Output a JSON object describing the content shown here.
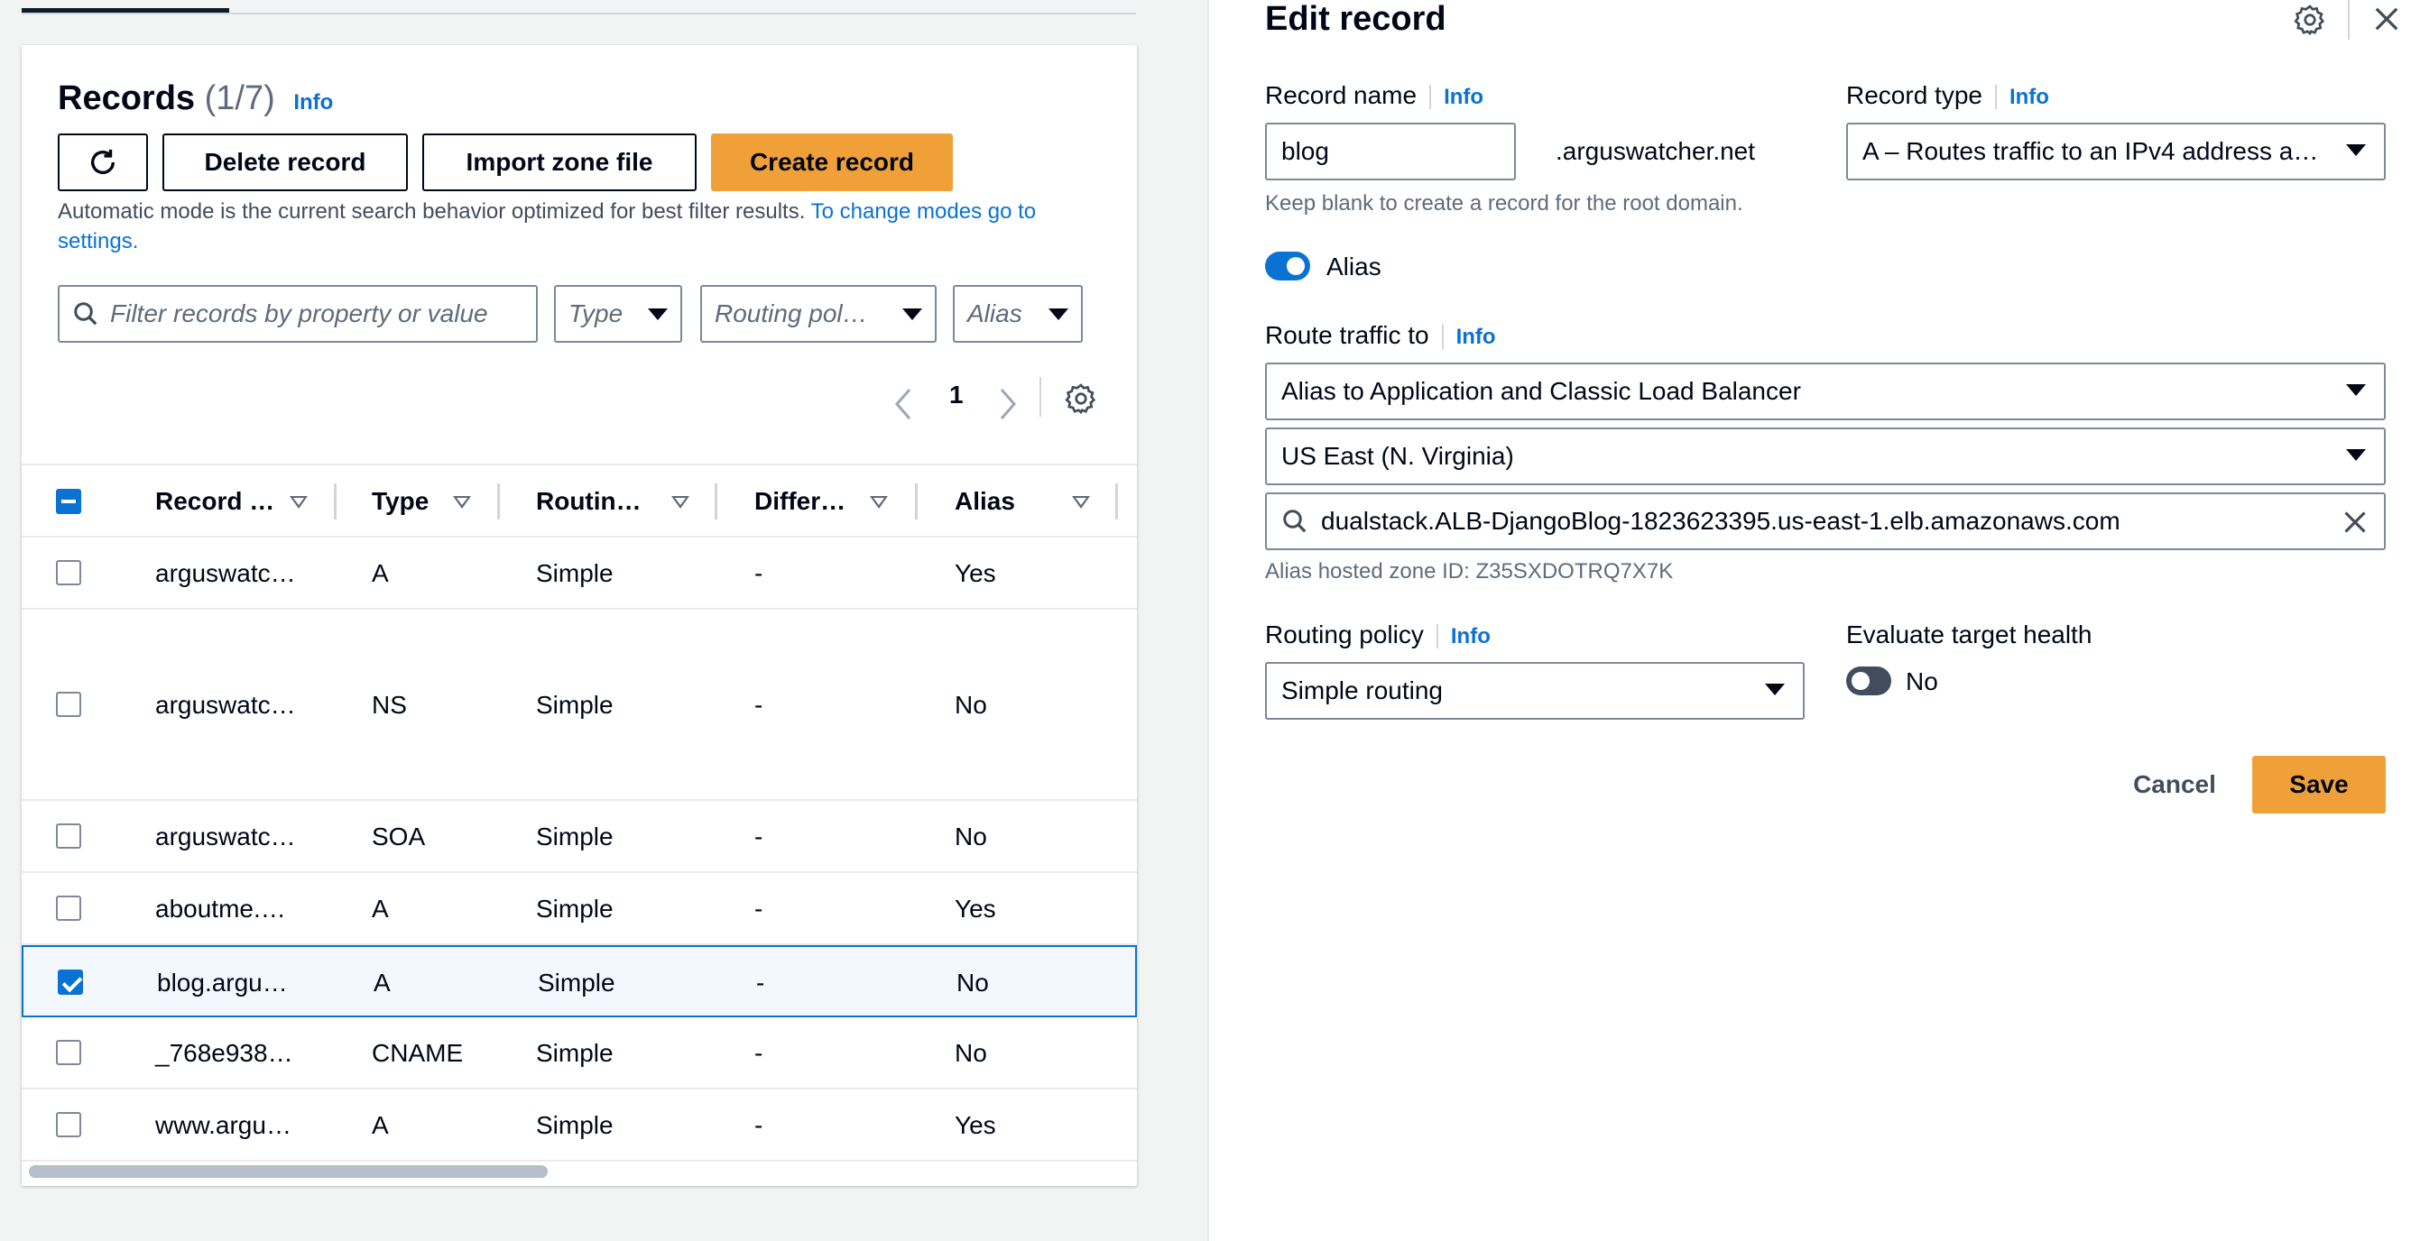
{
  "records": {
    "title": "Records",
    "count": "(1/7)",
    "info": "Info",
    "buttons": {
      "delete": "Delete record",
      "import": "Import zone file",
      "create": "Create record"
    },
    "hint_text": "Automatic mode is the current search behavior optimized for best filter results.",
    "hint_link": "To change modes go to settings.",
    "filters": {
      "search_placeholder": "Filter records by property or value",
      "type": "Type",
      "routing": "Routing pol…",
      "alias": "Alias"
    },
    "page": "1",
    "columns": [
      "Record …",
      "Type",
      "Routin…",
      "Differ…",
      "Alias"
    ],
    "rows": [
      {
        "name": "arguswatc…",
        "type": "A",
        "routing": "Simple",
        "diff": "-",
        "alias": "Yes",
        "checked": false
      },
      {
        "name": "arguswatc…",
        "type": "NS",
        "routing": "Simple",
        "diff": "-",
        "alias": "No",
        "checked": false
      },
      {
        "name": "arguswatc…",
        "type": "SOA",
        "routing": "Simple",
        "diff": "-",
        "alias": "No",
        "checked": false
      },
      {
        "name": "aboutme.…",
        "type": "A",
        "routing": "Simple",
        "diff": "-",
        "alias": "Yes",
        "checked": false
      },
      {
        "name": "blog.argu…",
        "type": "A",
        "routing": "Simple",
        "diff": "-",
        "alias": "No",
        "checked": true
      },
      {
        "name": "_768e938…",
        "type": "CNAME",
        "routing": "Simple",
        "diff": "-",
        "alias": "No",
        "checked": false
      },
      {
        "name": "www.argu…",
        "type": "A",
        "routing": "Simple",
        "diff": "-",
        "alias": "Yes",
        "checked": false
      }
    ]
  },
  "editor": {
    "title": "Edit record",
    "record_name_label": "Record name",
    "record_name_value": "blog",
    "domain_suffix": ".arguswatcher.net",
    "record_name_hint": "Keep blank to create a record for the root domain.",
    "record_type_label": "Record type",
    "record_type_value": "A – Routes traffic to an IPv4 address a…",
    "alias_label": "Alias",
    "alias_on": true,
    "route_label": "Route traffic to",
    "route_target": "Alias to Application and Classic Load Balancer",
    "region": "US East (N. Virginia)",
    "endpoint": "dualstack.ALB-DjangoBlog-1823623395.us-east-1.elb.amazonaws.com",
    "hosted_zone": "Alias hosted zone ID: Z35SXDOTRQ7X7K",
    "routing_policy_label": "Routing policy",
    "routing_policy_value": "Simple routing",
    "eval_health_label": "Evaluate target health",
    "eval_health_value": "No",
    "eval_health_on": false,
    "info": "Info",
    "cancel": "Cancel",
    "save": "Save"
  },
  "colors": {
    "primary": "#f0a039",
    "link": "#0972d3",
    "toggle_on": "#0972d3",
    "toggle_off": "#414d5c"
  }
}
